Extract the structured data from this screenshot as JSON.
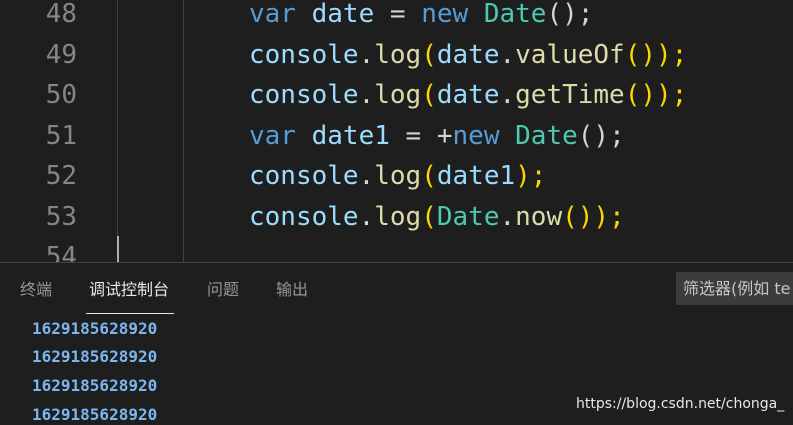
{
  "editor": {
    "lines": [
      {
        "number": "48",
        "t1": "var",
        "t2": " date ",
        "t3": "=",
        "t4": " new ",
        "t5": "Date",
        "t6": "();"
      },
      {
        "number": "49",
        "t1": "console",
        "t2": ".",
        "t3": "log",
        "t4": "(",
        "t5": "date",
        "t6": ".",
        "t7": "valueOf",
        "t8": "());"
      },
      {
        "number": "50",
        "t1": "console",
        "t2": ".",
        "t3": "log",
        "t4": "(",
        "t5": "date",
        "t6": ".",
        "t7": "getTime",
        "t8": "());"
      },
      {
        "number": "51",
        "t1": "var",
        "t2": " date1 ",
        "t3": "= +",
        "t4": "new ",
        "t5": "Date",
        "t6": "();"
      },
      {
        "number": "52",
        "t1": "console",
        "t2": ".",
        "t3": "log",
        "t4": "(",
        "t5": "date1",
        "t6": ");"
      },
      {
        "number": "53",
        "t1": "console",
        "t2": ".",
        "t3": "log",
        "t4": "(",
        "t5": "Date",
        "t6": ".",
        "t7": "now",
        "t8": "());"
      },
      {
        "number": "54"
      }
    ]
  },
  "panel": {
    "tabs": [
      "终端",
      "调试控制台",
      "问题",
      "输出"
    ],
    "active_tab": "调试控制台",
    "filter_placeholder": "筛选器(例如 te",
    "output": [
      "1629185628920",
      "1629185628920",
      "1629185628920",
      "1629185628920"
    ]
  },
  "watermark": "https://blog.csdn.net/chonga_"
}
